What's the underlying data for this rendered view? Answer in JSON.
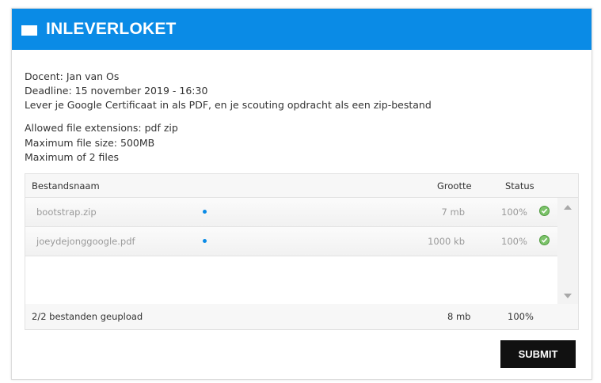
{
  "header": {
    "title": "INLEVERLOKET",
    "icon": "envelope-icon",
    "color": "#0a8be6"
  },
  "info": {
    "teacher": "Docent: Jan van Os",
    "deadline": "Deadline: 15 november 2019 - 16:30",
    "instruction": "Lever je Google Certificaat in als PDF, en je scouting opdracht als een zip-bestand"
  },
  "limits": {
    "extensions": "Allowed file extensions: pdf zip",
    "max_size": "Maximum file size: 500MB",
    "max_files": "Maximum of 2 files"
  },
  "table": {
    "headers": {
      "name": "Bestandsnaam",
      "size": "Grootte",
      "status": "Status"
    },
    "rows": [
      {
        "name": "bootstrap.zip",
        "size": "7 mb",
        "status": "100%",
        "status_icon": "check-circle-icon"
      },
      {
        "name": "joeydejonggoogle.pdf",
        "size": "1000 kb",
        "status": "100%",
        "status_icon": "check-circle-icon"
      }
    ],
    "footer": {
      "summary": "2/2 bestanden geupload",
      "total_size": "8 mb",
      "total_status": "100%"
    }
  },
  "actions": {
    "submit_label": "SUBMIT"
  }
}
